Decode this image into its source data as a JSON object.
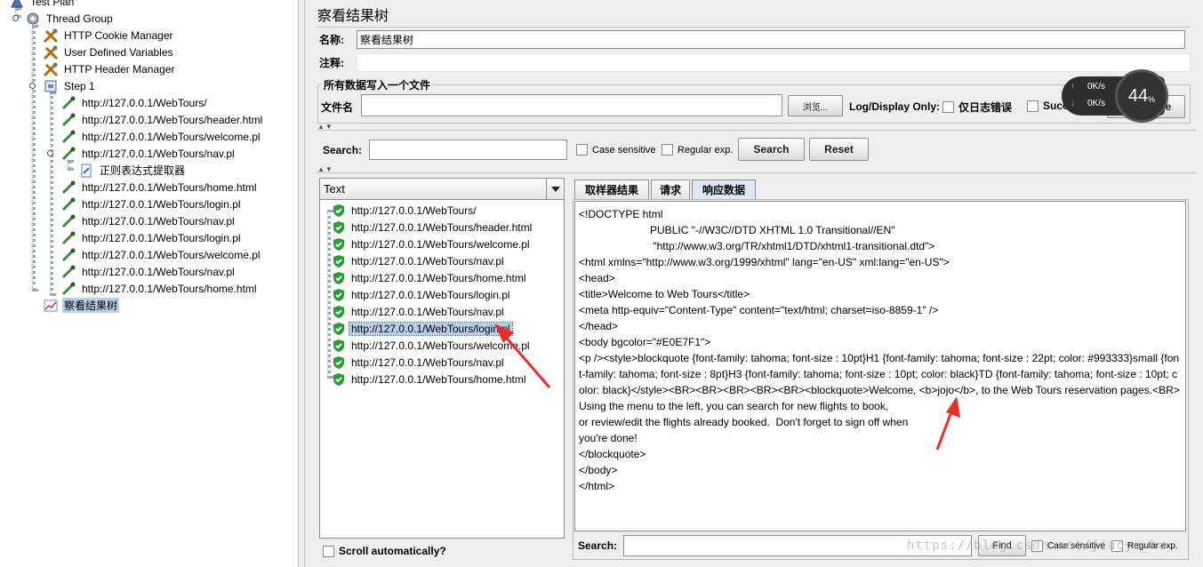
{
  "tree": {
    "test_plan": "Test Plan",
    "thread_group": "Thread Group",
    "cookie_manager": "HTTP Cookie Manager",
    "user_vars": "User Defined Variables",
    "header_manager": "HTTP Header Manager",
    "step1": "Step 1",
    "samplers": [
      "http://127.0.0.1/WebTours/",
      "http://127.0.0.1/WebTours/header.html",
      "http://127.0.0.1/WebTours/welcome.pl",
      "http://127.0.0.1/WebTours/nav.pl"
    ],
    "regex_extractor": "正则表达式提取器",
    "samplers2": [
      "http://127.0.0.1/WebTours/home.html",
      "http://127.0.0.1/WebTours/login.pl",
      "http://127.0.0.1/WebTours/nav.pl",
      "http://127.0.0.1/WebTours/login.pl",
      "http://127.0.0.1/WebTours/welcome.pl",
      "http://127.0.0.1/WebTours/nav.pl",
      "http://127.0.0.1/WebTours/home.html"
    ],
    "listener": "察看结果树"
  },
  "panel": {
    "title": "察看结果树",
    "name_label": "名称:",
    "name_value": "察看结果树",
    "comment_label": "注释:",
    "file_group_title": "所有数据写入一个文件",
    "filename_label": "文件名",
    "browse_label": "浏览...",
    "log_display_label": "Log/Display Only:",
    "errors_only_label": "仅日志错误",
    "successes_label": "Successes",
    "configure_label": "Configure"
  },
  "search": {
    "label": "Search:",
    "case_sensitive": "Case sensitive",
    "regular_exp": "Regular exp.",
    "search_button": "Search",
    "reset_button": "Reset"
  },
  "results": {
    "renderer": "Text",
    "items": [
      "http://127.0.0.1/WebTours/",
      "http://127.0.0.1/WebTours/header.html",
      "http://127.0.0.1/WebTours/welcome.pl",
      "http://127.0.0.1/WebTours/nav.pl",
      "http://127.0.0.1/WebTours/home.html",
      "http://127.0.0.1/WebTours/login.pl",
      "http://127.0.0.1/WebTours/nav.pl",
      "http://127.0.0.1/WebTours/login.pl",
      "http://127.0.0.1/WebTours/welcome.pl",
      "http://127.0.0.1/WebTours/nav.pl",
      "http://127.0.0.1/WebTours/home.html"
    ],
    "selected_index": 7,
    "scroll_auto": "Scroll automatically?"
  },
  "tabs": {
    "sampler_result": "取样器结果",
    "request": "请求",
    "response_data": "响应数据"
  },
  "response_text": "<!DOCTYPE html\n                        PUBLIC \"-//W3C//DTD XHTML 1.0 Transitional//EN\"\n                         \"http://www.w3.org/TR/xhtml1/DTD/xhtml1-transitional.dtd\">\n<html xmlns=\"http://www.w3.org/1999/xhtml\" lang=\"en-US\" xml:lang=\"en-US\">\n<head>\n<title>Welcome to Web Tours</title>\n<meta http-equiv=\"Content-Type\" content=\"text/html; charset=iso-8859-1\" />\n</head>\n<body bgcolor=\"#E0E7F1\">\n<p /><style>blockquote {font-family: tahoma; font-size : 10pt}H1 {font-family: tahoma; font-size : 22pt; color: #993333}small {font-family: tahoma; font-size : 8pt}H3 {font-family: tahoma; font-size : 10pt; color: black}TD {font-family: tahoma; font-size : 10pt; color: black}</style><BR><BR><BR><BR><BR><blockquote>Welcome, <b>jojo</b>, to the Web Tours reservation pages.<BR>Using the menu to the left, you can search for new flights to book,\nor review/edit the flights already booked.  Don't forget to sign off when\nyou're done!\n</blockquote>\n</body>\n</html>",
  "bottom_search": {
    "label": "Search:",
    "find_button": "Find",
    "case_sensitive": "Case sensitive",
    "regular_exp": "Regular exp."
  },
  "net_widget": {
    "up": "0K/s",
    "down": "0K/s",
    "percent": "44",
    "percent_sign": "%"
  },
  "watermark": "https://blog.csdn.net/jiaoyu_hu"
}
